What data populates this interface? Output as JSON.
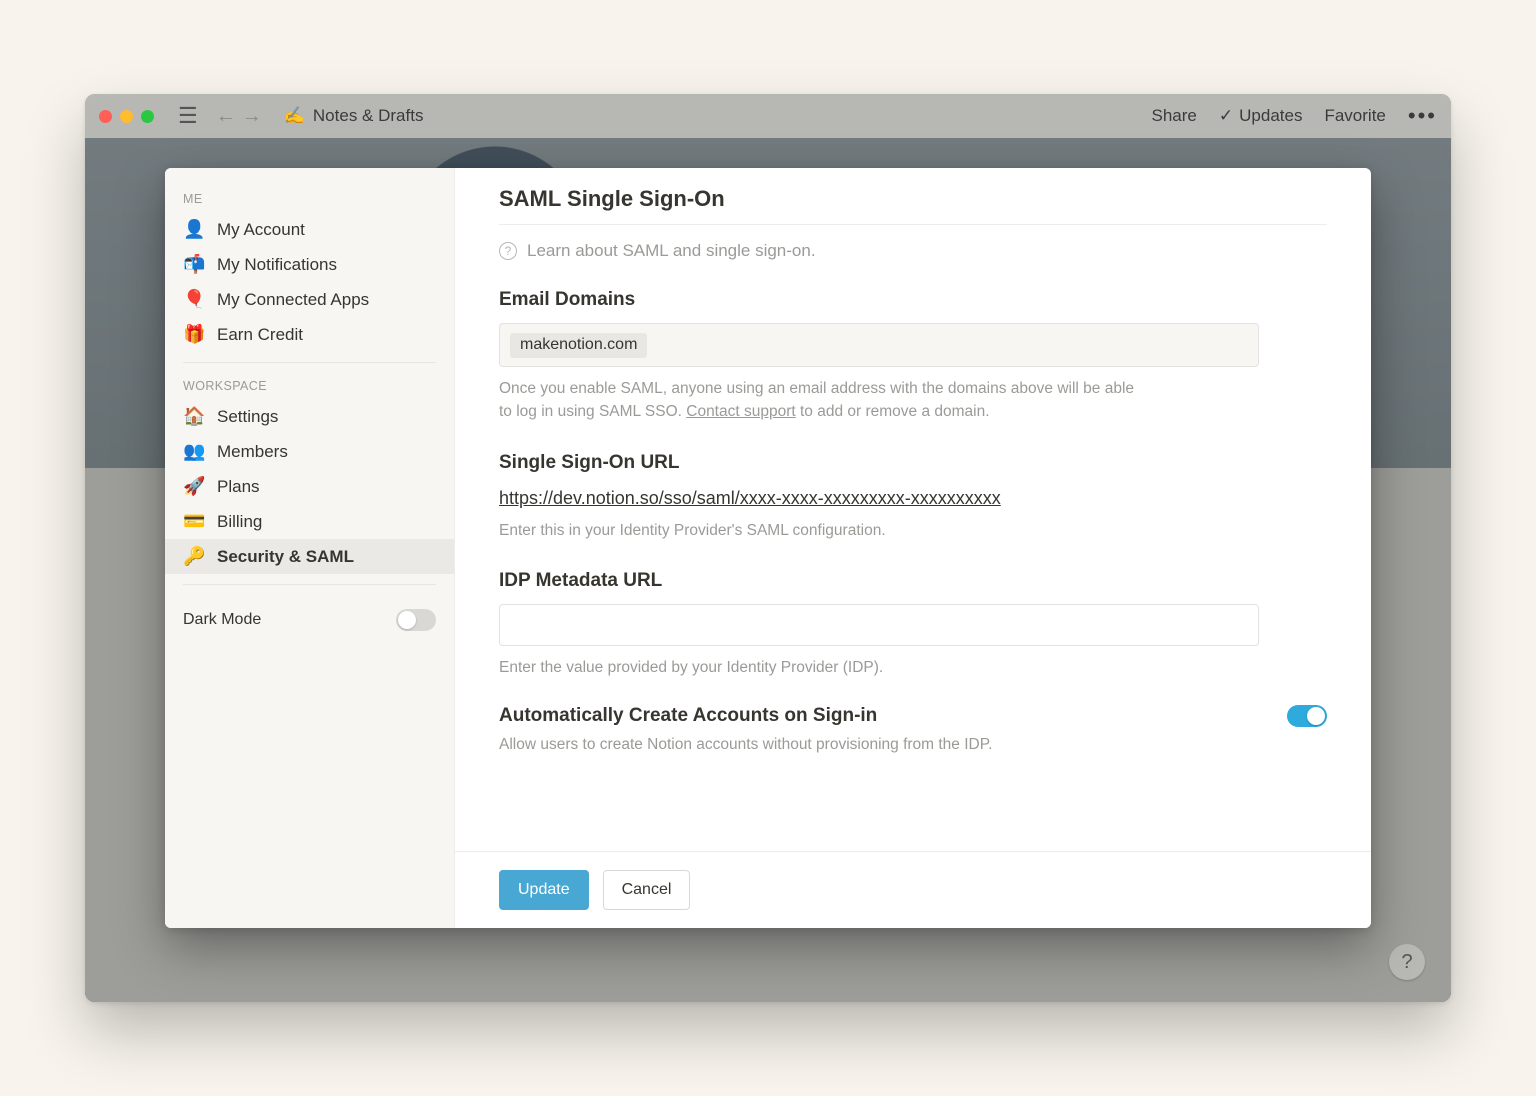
{
  "titlebar": {
    "doc_icon": "✍️",
    "doc_title": "Notes & Drafts",
    "share": "Share",
    "updates": "Updates",
    "favorite": "Favorite"
  },
  "sidebar": {
    "me_label": "ME",
    "workspace_label": "WORKSPACE",
    "me_items": [
      {
        "icon": "👤",
        "label": "My Account"
      },
      {
        "icon": "📬",
        "label": "My Notifications"
      },
      {
        "icon": "🎈",
        "label": "My Connected Apps"
      },
      {
        "icon": "🎁",
        "label": "Earn Credit"
      }
    ],
    "ws_items": [
      {
        "icon": "🏠",
        "label": "Settings"
      },
      {
        "icon": "👥",
        "label": "Members"
      },
      {
        "icon": "🚀",
        "label": "Plans"
      },
      {
        "icon": "💳",
        "label": "Billing"
      },
      {
        "icon": "🔑",
        "label": "Security & SAML"
      }
    ],
    "dark_mode_label": "Dark Mode",
    "dark_mode_on": false
  },
  "panel": {
    "title": "SAML Single Sign-On",
    "learn": "Learn about SAML and single sign-on.",
    "email_domains": {
      "title": "Email Domains",
      "chips": [
        "makenotion.com"
      ],
      "help_pre": "Once you enable SAML, anyone using an email address with the domains above will be able to log in using SAML SSO. ",
      "help_link": "Contact support",
      "help_post": " to add or remove a domain."
    },
    "sso": {
      "title": "Single Sign-On URL",
      "url": "https://dev.notion.so/sso/saml/xxxx-xxxx-xxxxxxxxx-xxxxxxxxxx",
      "help": "Enter this in your Identity Provider's SAML configuration."
    },
    "idp": {
      "title": "IDP Metadata URL",
      "value": "",
      "help": "Enter the value provided by your Identity Provider (IDP)."
    },
    "auto": {
      "title": "Automatically Create Accounts on Sign-in",
      "help": "Allow users to create Notion accounts without provisioning from the IDP.",
      "on": true
    },
    "footer": {
      "update": "Update",
      "cancel": "Cancel"
    }
  },
  "help_badge": "?"
}
